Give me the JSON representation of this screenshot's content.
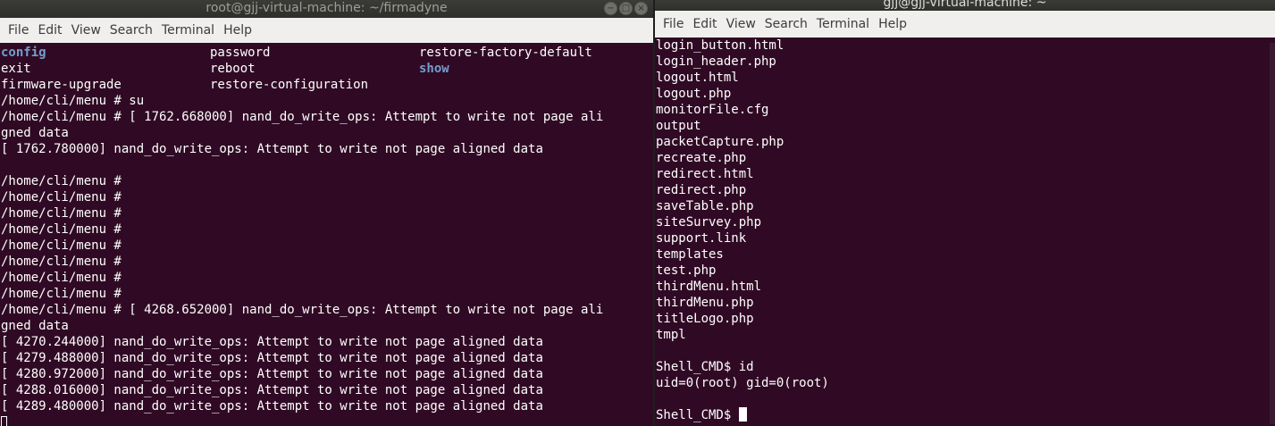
{
  "left": {
    "title": "root@gjj-virtual-machine: ~/firmadyne",
    "menu": [
      "File",
      "Edit",
      "View",
      "Search",
      "Terminal",
      "Help"
    ],
    "columns_rows": [
      [
        {
          "t": "config",
          "b": true
        },
        {
          "t": "password",
          "b": false
        },
        {
          "t": "restore-factory-default",
          "b": false
        }
      ],
      [
        {
          "t": "exit",
          "b": false
        },
        {
          "t": "reboot",
          "b": false
        },
        {
          "t": "show",
          "b": true
        }
      ],
      [
        {
          "t": "firmware-upgrade",
          "b": false
        },
        {
          "t": "restore-configuration",
          "b": false
        },
        {
          "t": "",
          "b": false
        }
      ]
    ],
    "lines": [
      "/home/cli/menu # su",
      "/home/cli/menu # [ 1762.668000] nand_do_write_ops: Attempt to write not page ali",
      "gned data",
      "[ 1762.780000] nand_do_write_ops: Attempt to write not page aligned data",
      "",
      "/home/cli/menu #",
      "/home/cli/menu #",
      "/home/cli/menu #",
      "/home/cli/menu #",
      "/home/cli/menu #",
      "/home/cli/menu #",
      "/home/cli/menu #",
      "/home/cli/menu #",
      "/home/cli/menu # [ 4268.652000] nand_do_write_ops: Attempt to write not page ali",
      "gned data",
      "[ 4270.244000] nand_do_write_ops: Attempt to write not page aligned data",
      "[ 4279.488000] nand_do_write_ops: Attempt to write not page aligned data",
      "[ 4280.972000] nand_do_write_ops: Attempt to write not page aligned data",
      "[ 4288.016000] nand_do_write_ops: Attempt to write not page aligned data",
      "[ 4289.480000] nand_do_write_ops: Attempt to write not page aligned data"
    ]
  },
  "right": {
    "title": "gjj@gjj-virtual-machine: ~",
    "menu": [
      "File",
      "Edit",
      "View",
      "Search",
      "Terminal",
      "Help"
    ],
    "lines": [
      "login_button.html",
      "login_header.php",
      "logout.html",
      "logout.php",
      "monitorFile.cfg",
      "output",
      "packetCapture.php",
      "recreate.php",
      "redirect.html",
      "redirect.php",
      "saveTable.php",
      "siteSurvey.php",
      "support.link",
      "templates",
      "test.php",
      "thirdMenu.html",
      "thirdMenu.php",
      "titleLogo.php",
      "tmpl",
      "",
      "Shell_CMD$ id",
      "uid=0(root) gid=0(root)",
      ""
    ],
    "prompt": "Shell_CMD$ "
  },
  "window_buttons": {
    "minimize": "−",
    "maximize": "□",
    "close": "×"
  }
}
